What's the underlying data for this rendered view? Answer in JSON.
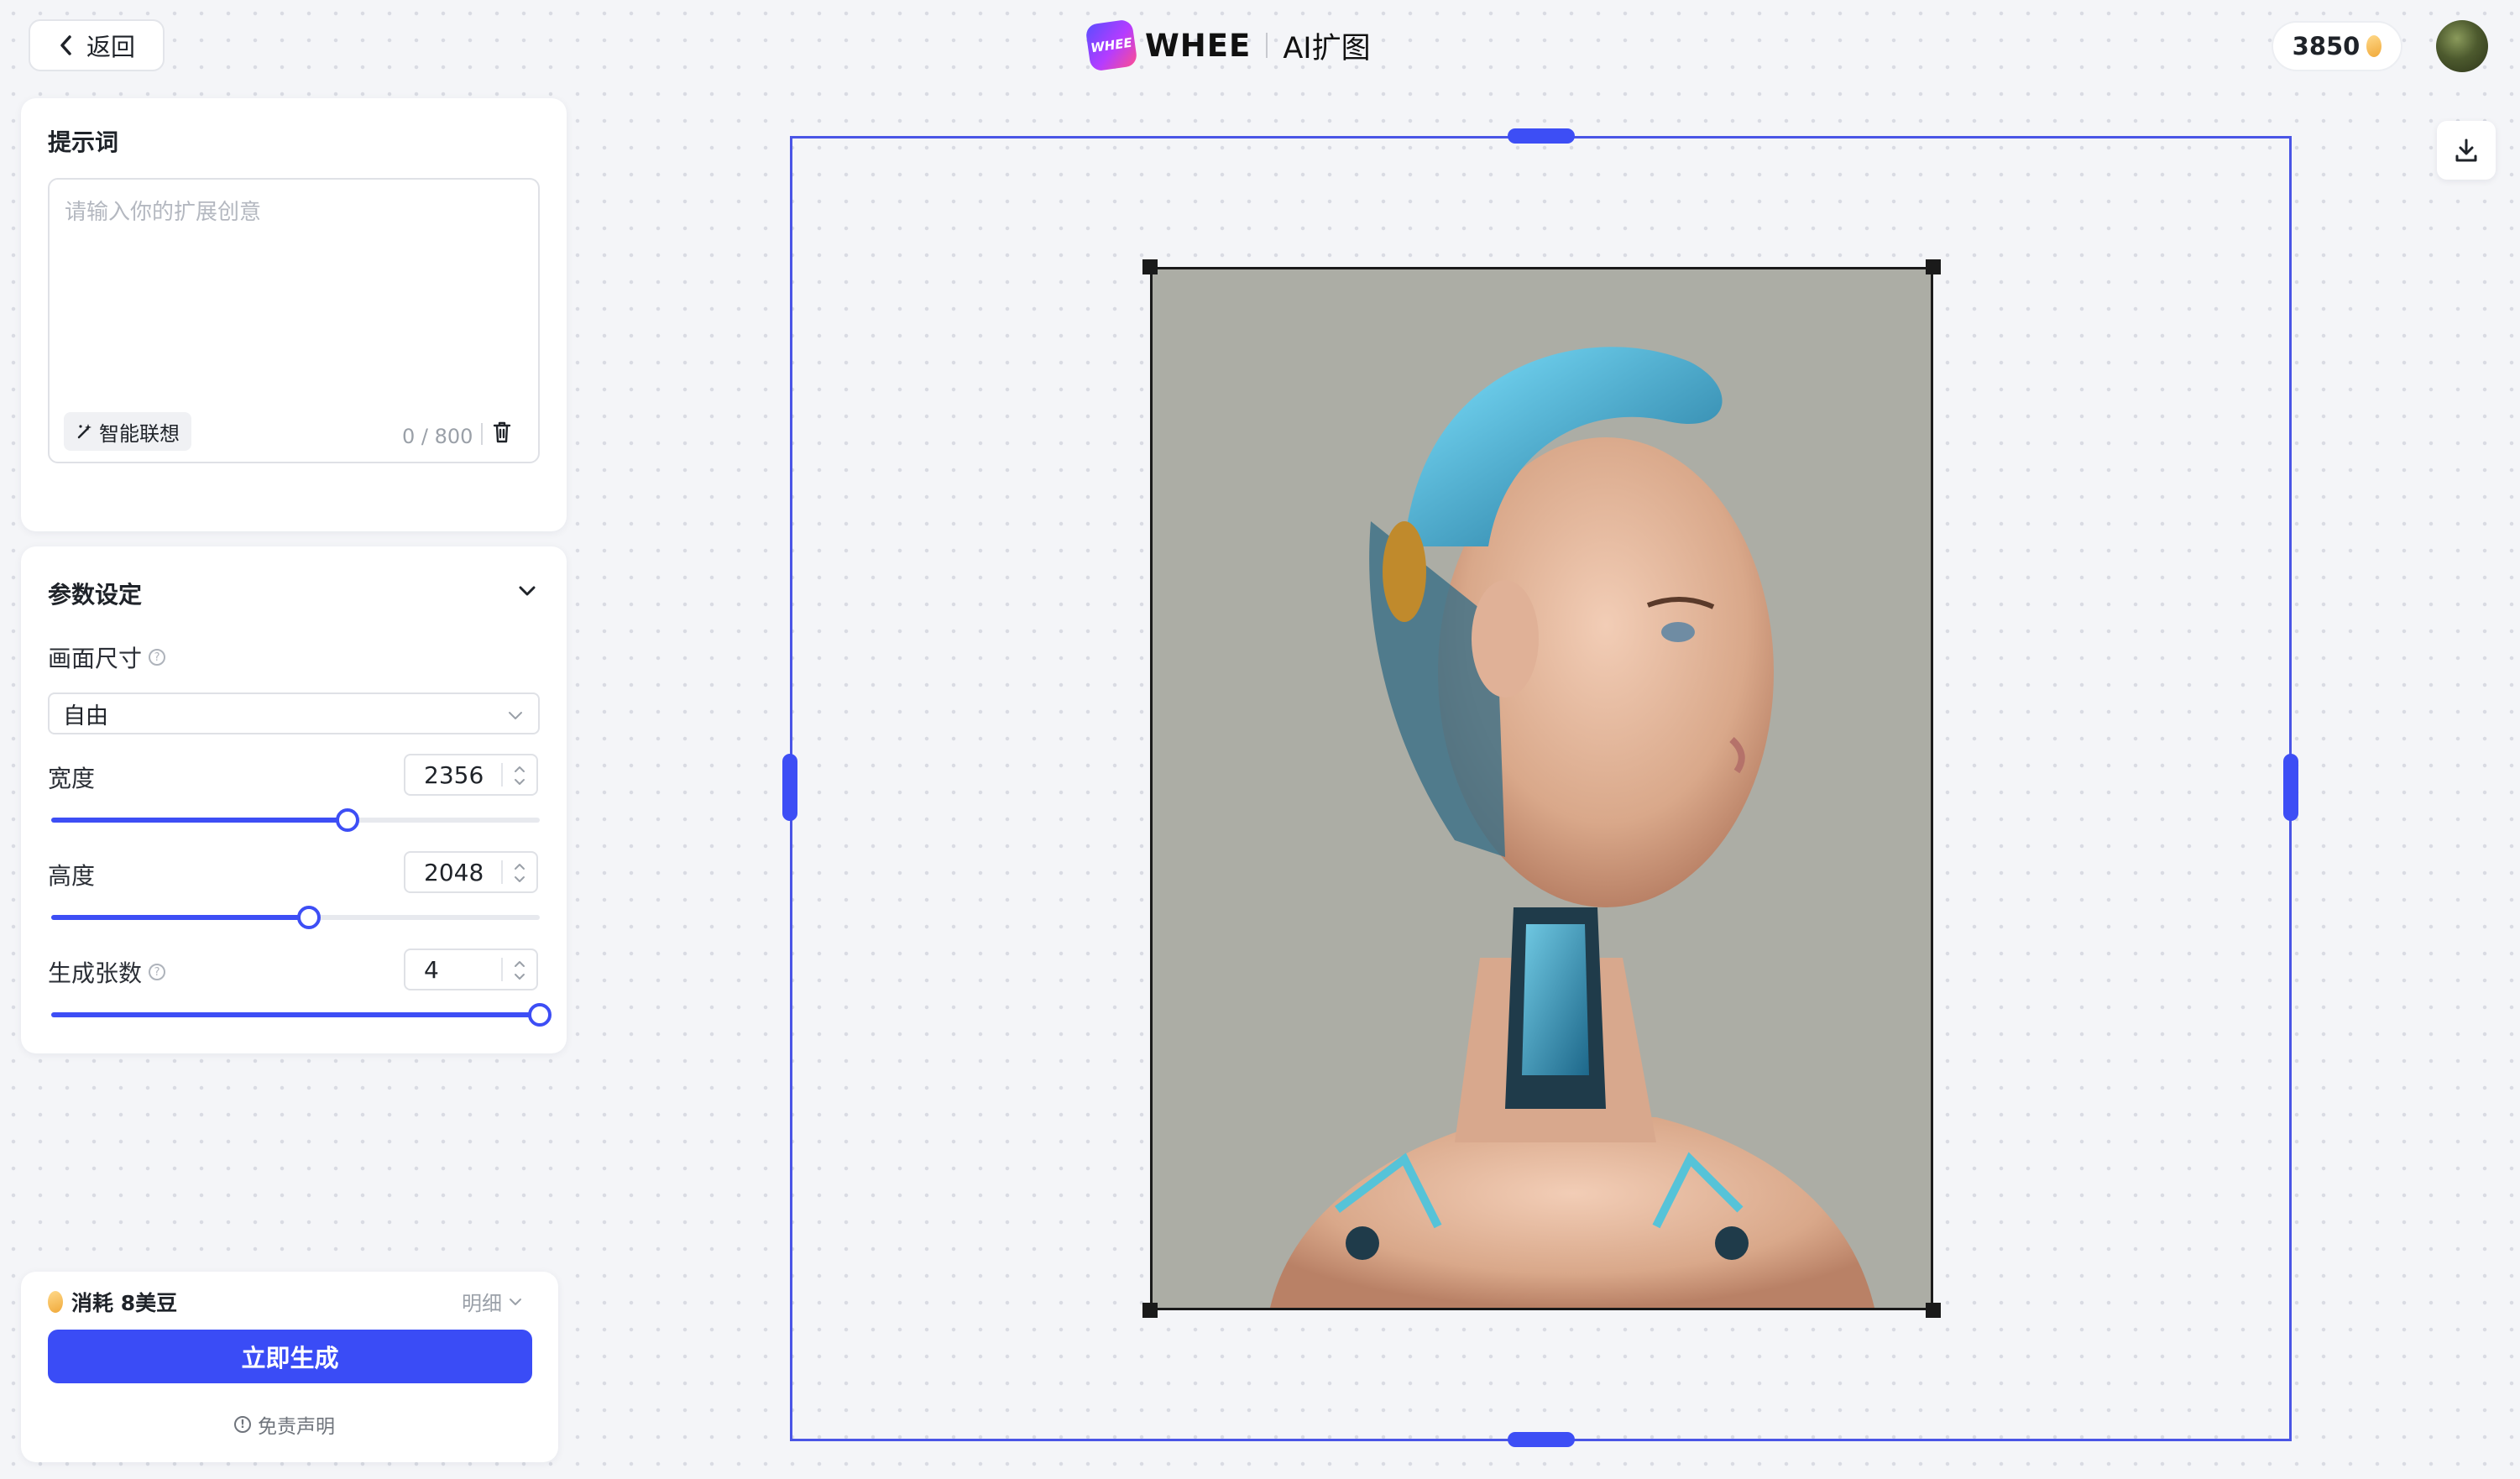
{
  "header": {
    "back_label": "返回",
    "brand_mark": "WHEE",
    "brand": "WHEE",
    "title": "AI扩图",
    "credits": "3850"
  },
  "prompt": {
    "title": "提示词",
    "placeholder": "请输入你的扩展创意",
    "value": "",
    "smart_label": "智能联想",
    "counter": "0 / 800"
  },
  "params": {
    "title": "参数设定",
    "size_label": "画面尺寸",
    "size_value": "自由",
    "width_label": "宽度",
    "width_value": "2356",
    "width_fraction": 0.61,
    "height_label": "高度",
    "height_value": "2048",
    "height_fraction": 0.53,
    "count_label": "生成张数",
    "count_value": "4",
    "count_fraction": 1.0
  },
  "generate": {
    "cost_label": "消耗 8美豆",
    "detail_label": "明细",
    "button_label": "立即生成",
    "disclaimer_label": "免责声明"
  },
  "colors": {
    "accent": "#3a4cf6",
    "frame": "#4a55e6",
    "background": "#f4f5f8"
  },
  "icons": {
    "back": "chevron-left-icon",
    "collapse": "chevron-down-icon",
    "help": "question-circle-icon",
    "clear": "trash-icon",
    "smart": "magic-wand-icon",
    "download": "download-icon",
    "info": "info-circle-icon"
  }
}
